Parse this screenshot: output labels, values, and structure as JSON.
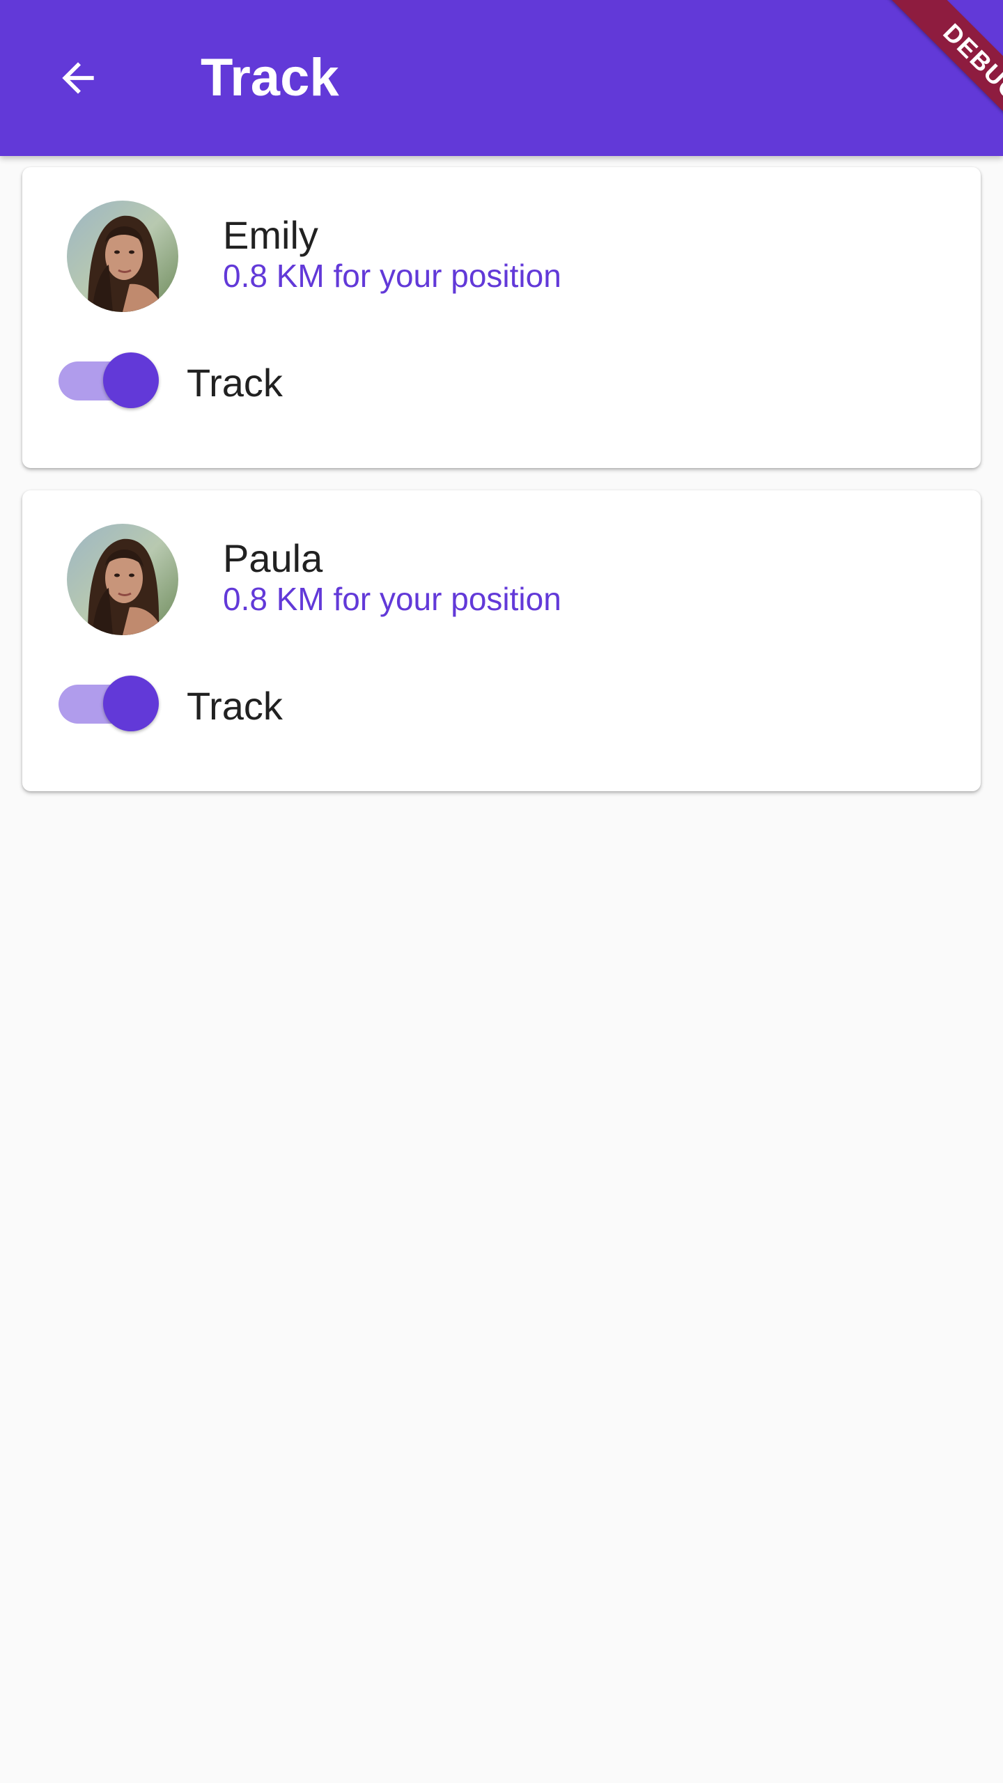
{
  "app_bar": {
    "title": "Track",
    "back_icon": "arrow-back-icon",
    "background": "#6239d8"
  },
  "debug_banner": {
    "label": "DEBUG",
    "color": "#8e1c3f"
  },
  "contacts": [
    {
      "name": "Emily",
      "distance": "0.8 KM for your position",
      "switch_label": "Track",
      "switch_on": true
    },
    {
      "name": "Paula",
      "distance": "0.8 KM for your position",
      "switch_label": "Track",
      "switch_on": true
    }
  ],
  "colors": {
    "accent": "#6239d8",
    "switch_track": "#b09cec",
    "text": "#212121",
    "background": "#fafafa"
  }
}
